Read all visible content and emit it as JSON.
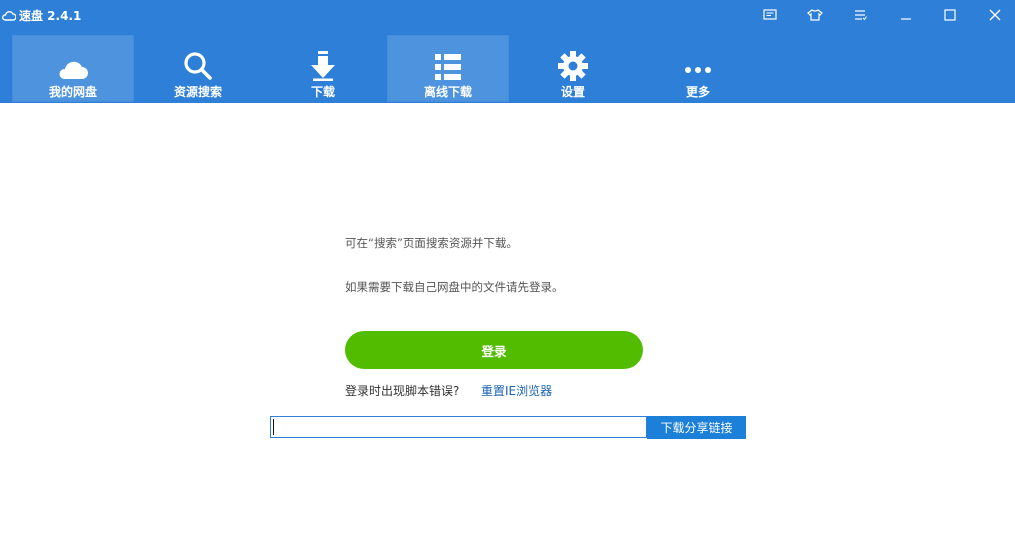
{
  "app": {
    "title": "速盘 2.4.1"
  },
  "window_controls": [
    {
      "name": "feedback-icon"
    },
    {
      "name": "skin-icon"
    },
    {
      "name": "menu-icon"
    },
    {
      "name": "minimize-icon"
    },
    {
      "name": "maximize-icon"
    },
    {
      "name": "close-icon"
    }
  ],
  "nav": {
    "items": [
      {
        "label": "我的网盘",
        "icon": "cloud-icon",
        "active": true
      },
      {
        "label": "资源搜索",
        "icon": "search-icon",
        "active": false
      },
      {
        "label": "下载",
        "icon": "download-icon",
        "active": false
      },
      {
        "label": "离线下载",
        "icon": "list-icon",
        "active": true
      },
      {
        "label": "设置",
        "icon": "gear-icon",
        "active": false
      },
      {
        "label": "更多",
        "icon": "more-icon",
        "active": false
      }
    ]
  },
  "main": {
    "line1": "可在“搜索”页面搜索资源并下载。",
    "line2": "如果需要下载自己网盘中的文件请先登录。",
    "login_label": "登录",
    "error_question": "登录时出现脚本错误?",
    "reset_link": "重置IE浏览器",
    "share_input_value": "",
    "share_input_placeholder": "",
    "share_button": "下载分享链接"
  },
  "colors": {
    "topbar": "#2d7fd8",
    "login": "#52bd00",
    "link": "#1a64b0",
    "share_button": "#1c7fd8"
  }
}
